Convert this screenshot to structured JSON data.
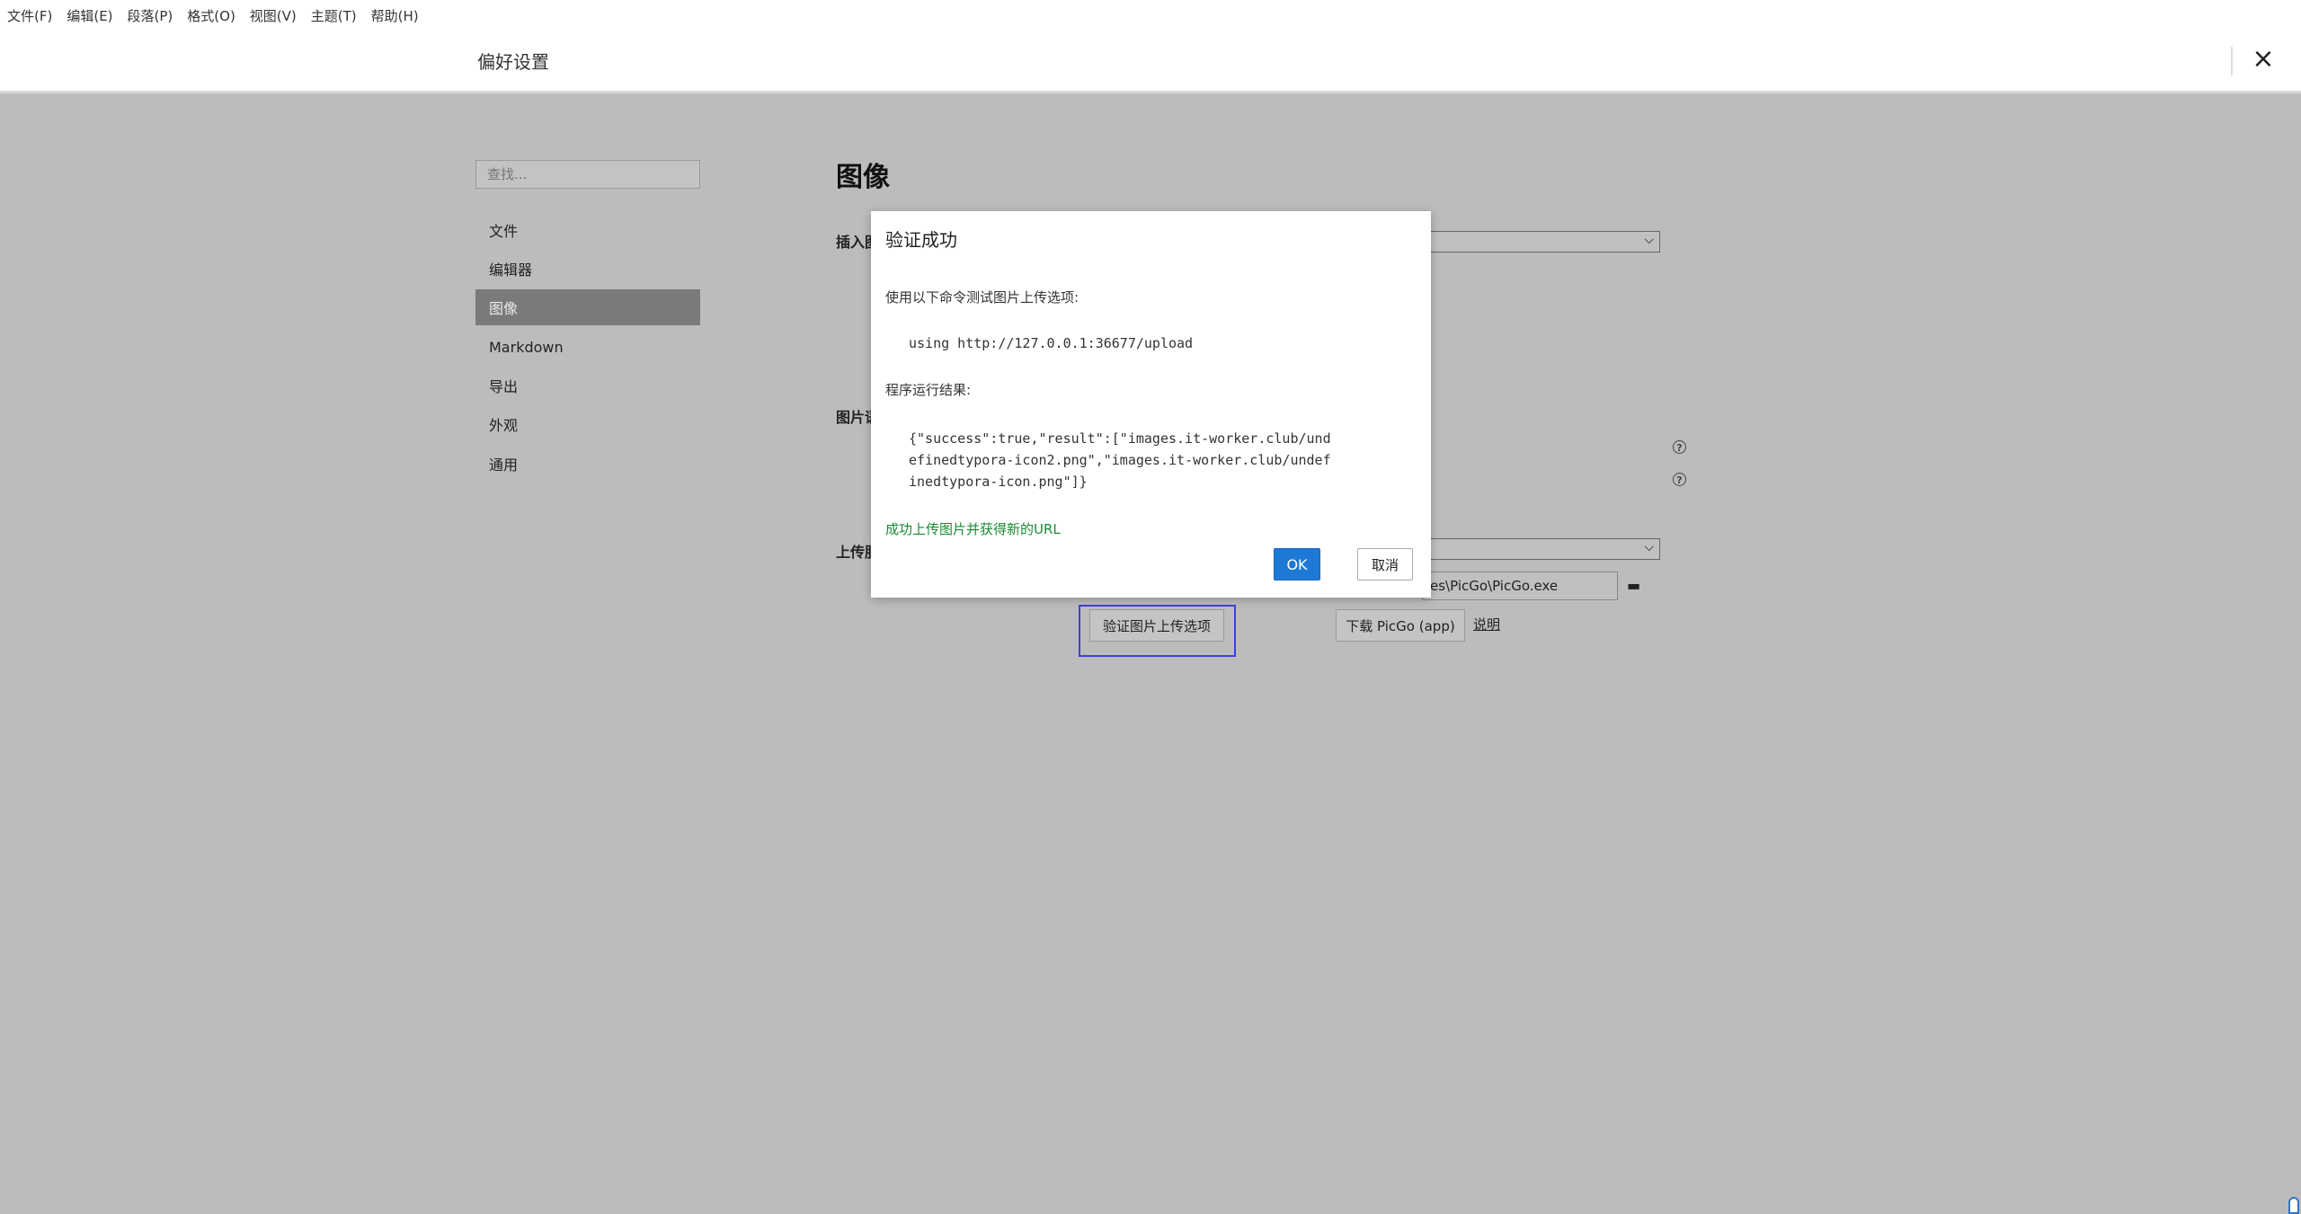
{
  "menubar": {
    "items": [
      "文件(F)",
      "编辑(E)",
      "段落(P)",
      "格式(O)",
      "视图(V)",
      "主题(T)",
      "帮助(H)"
    ]
  },
  "window": {
    "title": "偏好设置",
    "close_icon": "×"
  },
  "sidebar": {
    "search_placeholder": "查找...",
    "items": [
      {
        "label": "文件",
        "active": false
      },
      {
        "label": "编辑器",
        "active": false
      },
      {
        "label": "图像",
        "active": true
      },
      {
        "label": "Markdown",
        "active": false
      },
      {
        "label": "导出",
        "active": false
      },
      {
        "label": "外观",
        "active": false
      },
      {
        "label": "通用",
        "active": false
      }
    ]
  },
  "main": {
    "heading": "图像",
    "insert_label": "插入图",
    "image_syntax_label": "图片语",
    "upload_service_label": "上传服",
    "picgo_path": "es\\PicGo\\PicGo.exe",
    "verify_button": "验证图片上传选项",
    "download_button": "下载 PicGo (app)",
    "help_link": "说明",
    "help_icon": "?"
  },
  "dialog": {
    "title": "验证成功",
    "command_intro": "使用以下命令测试图片上传选项:",
    "command": "using http://127.0.0.1:36677/upload",
    "result_intro": "程序运行结果:",
    "result": "{\"success\":true,\"result\":[\"images.it-worker.club/undefinedtypora-icon2.png\",\"images.it-worker.club/undefinedtypora-icon.png\"]}",
    "success_message": "成功上传图片并获得新的URL",
    "ok_button": "OK",
    "cancel_button": "取消"
  }
}
